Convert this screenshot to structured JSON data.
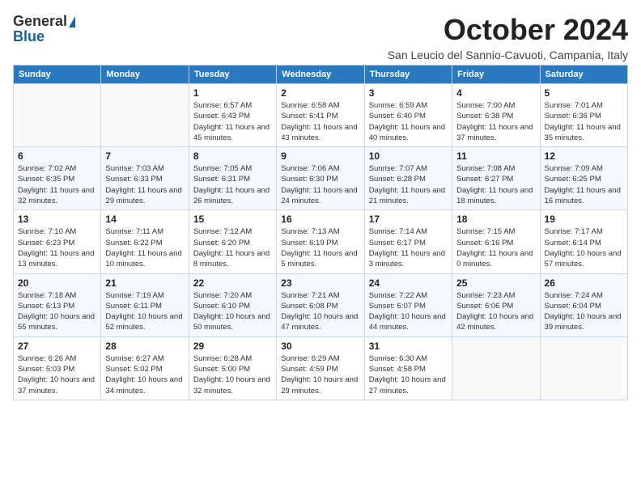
{
  "header": {
    "logo": {
      "general": "General",
      "blue": "Blue"
    },
    "title": "October 2024",
    "location": "San Leucio del Sannio-Cavuoti, Campania, Italy"
  },
  "weekdays": [
    "Sunday",
    "Monday",
    "Tuesday",
    "Wednesday",
    "Thursday",
    "Friday",
    "Saturday"
  ],
  "weeks": [
    [
      {
        "day": null
      },
      {
        "day": null
      },
      {
        "day": "1",
        "sunrise": "Sunrise: 6:57 AM",
        "sunset": "Sunset: 6:43 PM",
        "daylight": "Daylight: 11 hours and 45 minutes."
      },
      {
        "day": "2",
        "sunrise": "Sunrise: 6:58 AM",
        "sunset": "Sunset: 6:41 PM",
        "daylight": "Daylight: 11 hours and 43 minutes."
      },
      {
        "day": "3",
        "sunrise": "Sunrise: 6:59 AM",
        "sunset": "Sunset: 6:40 PM",
        "daylight": "Daylight: 11 hours and 40 minutes."
      },
      {
        "day": "4",
        "sunrise": "Sunrise: 7:00 AM",
        "sunset": "Sunset: 6:38 PM",
        "daylight": "Daylight: 11 hours and 37 minutes."
      },
      {
        "day": "5",
        "sunrise": "Sunrise: 7:01 AM",
        "sunset": "Sunset: 6:36 PM",
        "daylight": "Daylight: 11 hours and 35 minutes."
      }
    ],
    [
      {
        "day": "6",
        "sunrise": "Sunrise: 7:02 AM",
        "sunset": "Sunset: 6:35 PM",
        "daylight": "Daylight: 11 hours and 32 minutes."
      },
      {
        "day": "7",
        "sunrise": "Sunrise: 7:03 AM",
        "sunset": "Sunset: 6:33 PM",
        "daylight": "Daylight: 11 hours and 29 minutes."
      },
      {
        "day": "8",
        "sunrise": "Sunrise: 7:05 AM",
        "sunset": "Sunset: 6:31 PM",
        "daylight": "Daylight: 11 hours and 26 minutes."
      },
      {
        "day": "9",
        "sunrise": "Sunrise: 7:06 AM",
        "sunset": "Sunset: 6:30 PM",
        "daylight": "Daylight: 11 hours and 24 minutes."
      },
      {
        "day": "10",
        "sunrise": "Sunrise: 7:07 AM",
        "sunset": "Sunset: 6:28 PM",
        "daylight": "Daylight: 11 hours and 21 minutes."
      },
      {
        "day": "11",
        "sunrise": "Sunrise: 7:08 AM",
        "sunset": "Sunset: 6:27 PM",
        "daylight": "Daylight: 11 hours and 18 minutes."
      },
      {
        "day": "12",
        "sunrise": "Sunrise: 7:09 AM",
        "sunset": "Sunset: 6:25 PM",
        "daylight": "Daylight: 11 hours and 16 minutes."
      }
    ],
    [
      {
        "day": "13",
        "sunrise": "Sunrise: 7:10 AM",
        "sunset": "Sunset: 6:23 PM",
        "daylight": "Daylight: 11 hours and 13 minutes."
      },
      {
        "day": "14",
        "sunrise": "Sunrise: 7:11 AM",
        "sunset": "Sunset: 6:22 PM",
        "daylight": "Daylight: 11 hours and 10 minutes."
      },
      {
        "day": "15",
        "sunrise": "Sunrise: 7:12 AM",
        "sunset": "Sunset: 6:20 PM",
        "daylight": "Daylight: 11 hours and 8 minutes."
      },
      {
        "day": "16",
        "sunrise": "Sunrise: 7:13 AM",
        "sunset": "Sunset: 6:19 PM",
        "daylight": "Daylight: 11 hours and 5 minutes."
      },
      {
        "day": "17",
        "sunrise": "Sunrise: 7:14 AM",
        "sunset": "Sunset: 6:17 PM",
        "daylight": "Daylight: 11 hours and 3 minutes."
      },
      {
        "day": "18",
        "sunrise": "Sunrise: 7:15 AM",
        "sunset": "Sunset: 6:16 PM",
        "daylight": "Daylight: 11 hours and 0 minutes."
      },
      {
        "day": "19",
        "sunrise": "Sunrise: 7:17 AM",
        "sunset": "Sunset: 6:14 PM",
        "daylight": "Daylight: 10 hours and 57 minutes."
      }
    ],
    [
      {
        "day": "20",
        "sunrise": "Sunrise: 7:18 AM",
        "sunset": "Sunset: 6:13 PM",
        "daylight": "Daylight: 10 hours and 55 minutes."
      },
      {
        "day": "21",
        "sunrise": "Sunrise: 7:19 AM",
        "sunset": "Sunset: 6:11 PM",
        "daylight": "Daylight: 10 hours and 52 minutes."
      },
      {
        "day": "22",
        "sunrise": "Sunrise: 7:20 AM",
        "sunset": "Sunset: 6:10 PM",
        "daylight": "Daylight: 10 hours and 50 minutes."
      },
      {
        "day": "23",
        "sunrise": "Sunrise: 7:21 AM",
        "sunset": "Sunset: 6:08 PM",
        "daylight": "Daylight: 10 hours and 47 minutes."
      },
      {
        "day": "24",
        "sunrise": "Sunrise: 7:22 AM",
        "sunset": "Sunset: 6:07 PM",
        "daylight": "Daylight: 10 hours and 44 minutes."
      },
      {
        "day": "25",
        "sunrise": "Sunrise: 7:23 AM",
        "sunset": "Sunset: 6:06 PM",
        "daylight": "Daylight: 10 hours and 42 minutes."
      },
      {
        "day": "26",
        "sunrise": "Sunrise: 7:24 AM",
        "sunset": "Sunset: 6:04 PM",
        "daylight": "Daylight: 10 hours and 39 minutes."
      }
    ],
    [
      {
        "day": "27",
        "sunrise": "Sunrise: 6:26 AM",
        "sunset": "Sunset: 5:03 PM",
        "daylight": "Daylight: 10 hours and 37 minutes."
      },
      {
        "day": "28",
        "sunrise": "Sunrise: 6:27 AM",
        "sunset": "Sunset: 5:02 PM",
        "daylight": "Daylight: 10 hours and 34 minutes."
      },
      {
        "day": "29",
        "sunrise": "Sunrise: 6:28 AM",
        "sunset": "Sunset: 5:00 PM",
        "daylight": "Daylight: 10 hours and 32 minutes."
      },
      {
        "day": "30",
        "sunrise": "Sunrise: 6:29 AM",
        "sunset": "Sunset: 4:59 PM",
        "daylight": "Daylight: 10 hours and 29 minutes."
      },
      {
        "day": "31",
        "sunrise": "Sunrise: 6:30 AM",
        "sunset": "Sunset: 4:58 PM",
        "daylight": "Daylight: 10 hours and 27 minutes."
      },
      {
        "day": null
      },
      {
        "day": null
      }
    ]
  ]
}
